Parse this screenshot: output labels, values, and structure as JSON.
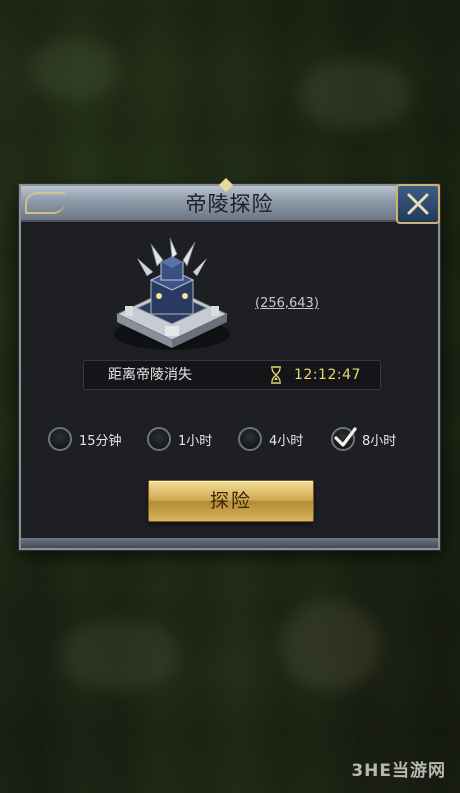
{
  "dialog": {
    "title": "帝陵探险",
    "close_icon": "close-x-icon",
    "tomb_image": "imperial-tomb-image",
    "coordinates": "(256,643)",
    "countdown": {
      "label": "距离帝陵消失",
      "icon": "hourglass-icon",
      "time": "12:12:47"
    },
    "options": [
      {
        "label": "15分钟",
        "selected": false
      },
      {
        "label": "1小时",
        "selected": false
      },
      {
        "label": "4小时",
        "selected": false
      },
      {
        "label": "8小时",
        "selected": true
      }
    ],
    "explore_button_label": "探险"
  },
  "watermark": "3HE当游网",
  "colors": {
    "countdown_time": "#e9d86c",
    "button_gold": "#cfa853",
    "close_button_blue": "#2d4a70",
    "frame_gold": "#c9b572"
  }
}
